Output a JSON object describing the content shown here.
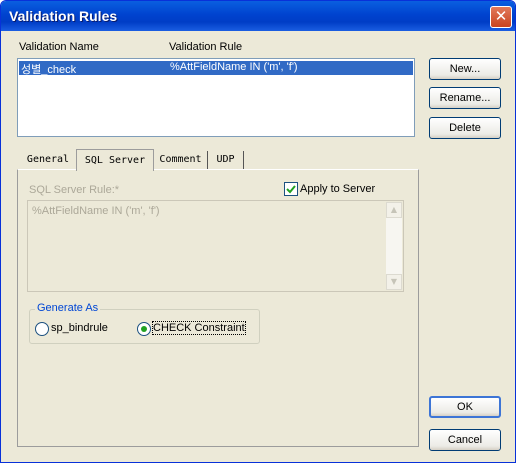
{
  "window": {
    "title": "Validation Rules",
    "close_glyph": "✕"
  },
  "rules_list": {
    "columns": [
      "Validation Name",
      "Validation Rule"
    ],
    "rows": [
      {
        "name": "성별_check",
        "rule": "%AttFieldName IN ('m', 'f')",
        "selected": true
      }
    ]
  },
  "side_buttons": {
    "new_label": "New...",
    "rename_label": "Rename...",
    "delete_label": "Delete"
  },
  "tabs": [
    {
      "label": "General",
      "active": false
    },
    {
      "label": "SQL Server",
      "active": true
    },
    {
      "label": "Comment",
      "active": false
    },
    {
      "label": "UDP",
      "active": false
    }
  ],
  "sql_server": {
    "rule_label": "SQL Server Rule:*",
    "apply_label": "Apply to Server",
    "apply_checked": true,
    "rule_text": "%AttFieldName IN ('m', 'f')",
    "generate_as": {
      "label": "Generate As",
      "options": [
        {
          "label": "sp_bindrule",
          "selected": false
        },
        {
          "label": "CHECK Constraint",
          "selected": true
        }
      ]
    }
  },
  "footer": {
    "ok_label": "OK",
    "cancel_label": "Cancel"
  },
  "colors": {
    "title_bar": "#0043cf",
    "selection": "#316ac5",
    "window_bg": "#ece9d8"
  }
}
